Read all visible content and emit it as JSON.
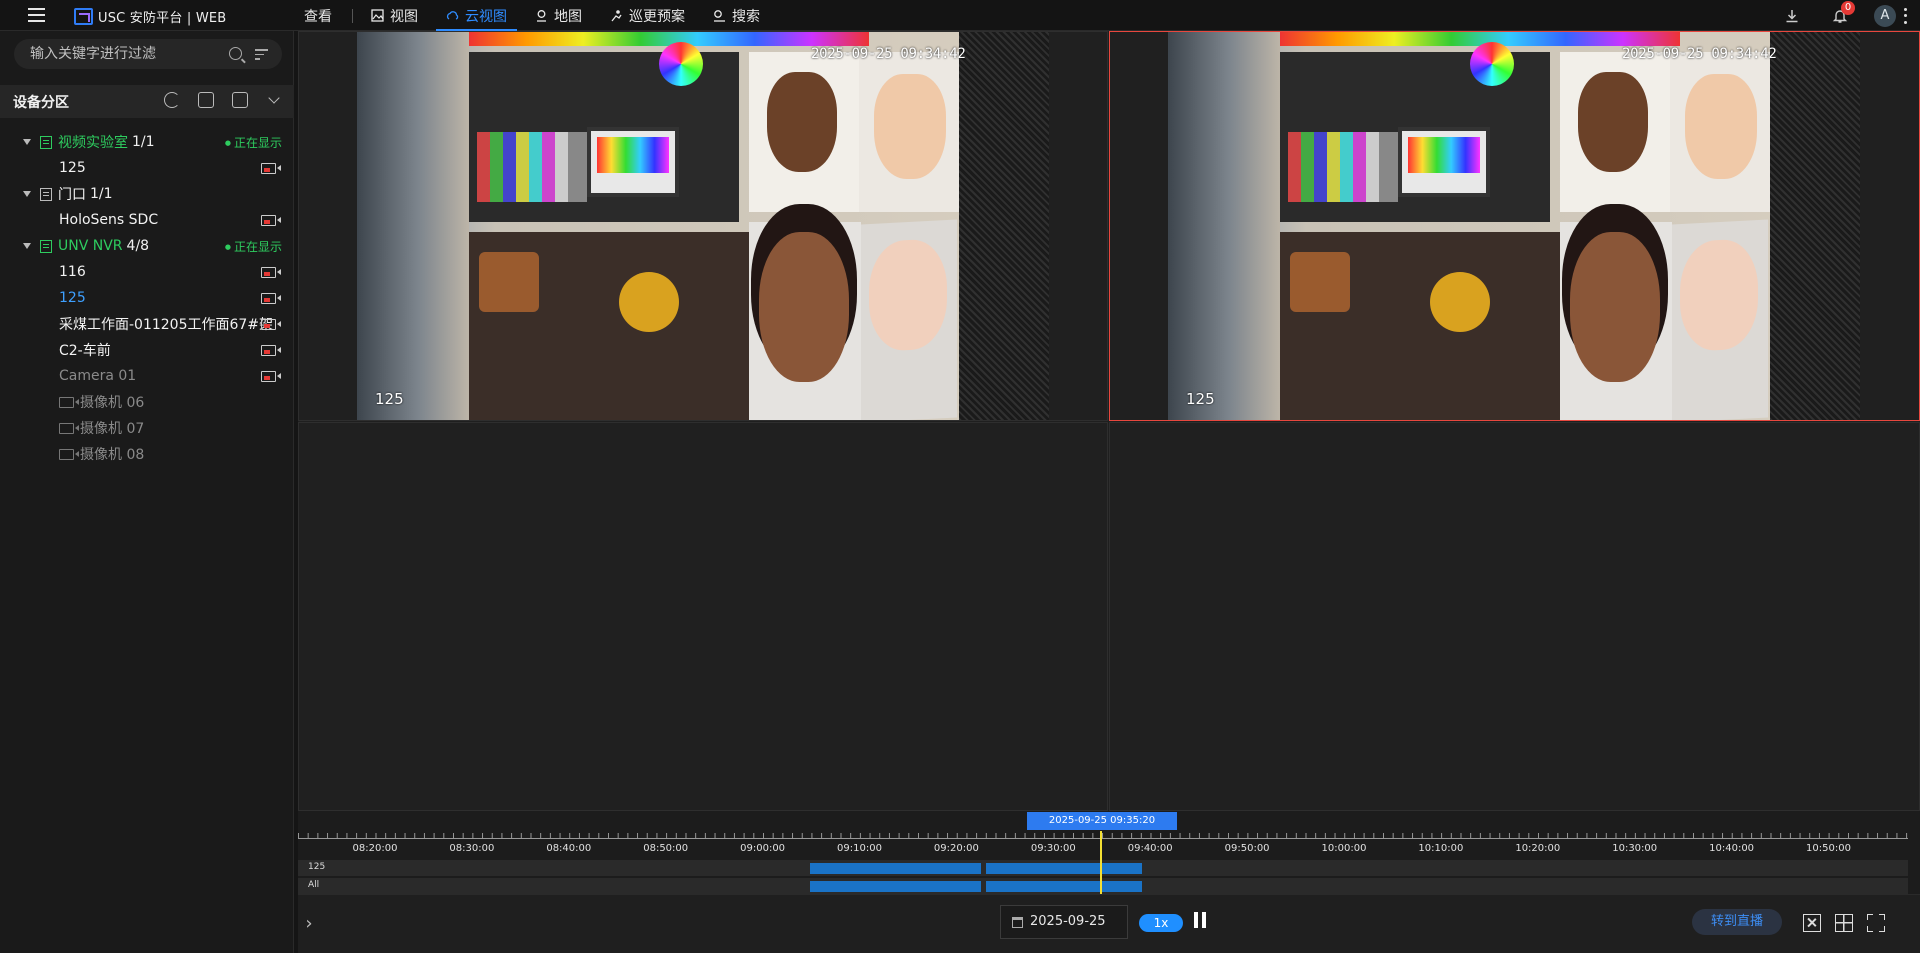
{
  "app": {
    "title": "USC 安防平台 | WEB"
  },
  "nav": {
    "view_label": "查看",
    "items": [
      {
        "label": "视图",
        "icon": "image-icon",
        "active": false
      },
      {
        "label": "云视图",
        "icon": "cloud-icon",
        "active": true
      },
      {
        "label": "地图",
        "icon": "map-pin-icon",
        "active": false
      },
      {
        "label": "巡更预案",
        "icon": "patrol-icon",
        "active": false
      },
      {
        "label": "搜索",
        "icon": "search-person-icon",
        "active": false
      }
    ]
  },
  "topright": {
    "notification_count": "0",
    "avatar_letter": "A"
  },
  "sidebar": {
    "filter_placeholder": "输入关键字进行过滤",
    "section_title": "设备分区",
    "groups": [
      {
        "name": "视频实验室",
        "count": "1/1",
        "status": "正在显示",
        "cameras": [
          {
            "name": "125"
          }
        ]
      },
      {
        "name": "门口",
        "count": "1/1",
        "cameras": [
          {
            "name": "HoloSens SDC"
          }
        ]
      },
      {
        "name": "UNV NVR",
        "count": "4/8",
        "status": "正在显示",
        "cameras": [
          {
            "name": "116"
          },
          {
            "name": "125"
          },
          {
            "name": "采煤工作面-011205工作面67#架"
          },
          {
            "name": "C2-车前"
          },
          {
            "name": "Camera 01"
          },
          {
            "name": "摄像机 06"
          },
          {
            "name": "摄像机 07"
          },
          {
            "name": "摄像机 08"
          }
        ]
      }
    ]
  },
  "video": {
    "cell1": {
      "timestamp": "2025-09-25 09:34:42",
      "channel": "125"
    },
    "cell2": {
      "timestamp": "2025-09-25 09:34:42",
      "channel": "125"
    }
  },
  "timeline": {
    "cursor_time": "2025-09-25 09:35:20",
    "ticks": [
      "08:20:00",
      "08:30:00",
      "08:40:00",
      "08:50:00",
      "09:00:00",
      "09:10:00",
      "09:20:00",
      "09:30:00",
      "09:40:00",
      "09:50:00",
      "10:00:00",
      "10:10:00",
      "10:20:00",
      "10:30:00",
      "10:40:00",
      "10:50:00"
    ],
    "tracks": [
      "125",
      "All"
    ]
  },
  "controls": {
    "date": "2025-09-25",
    "speed": "1x",
    "live_label": "转到直播"
  },
  "colors": {
    "accent": "#2f8cff",
    "online": "#2ecc5f",
    "record": "#1a73c7",
    "cursor": "#f4e033",
    "selected_border": "#e8473e"
  }
}
